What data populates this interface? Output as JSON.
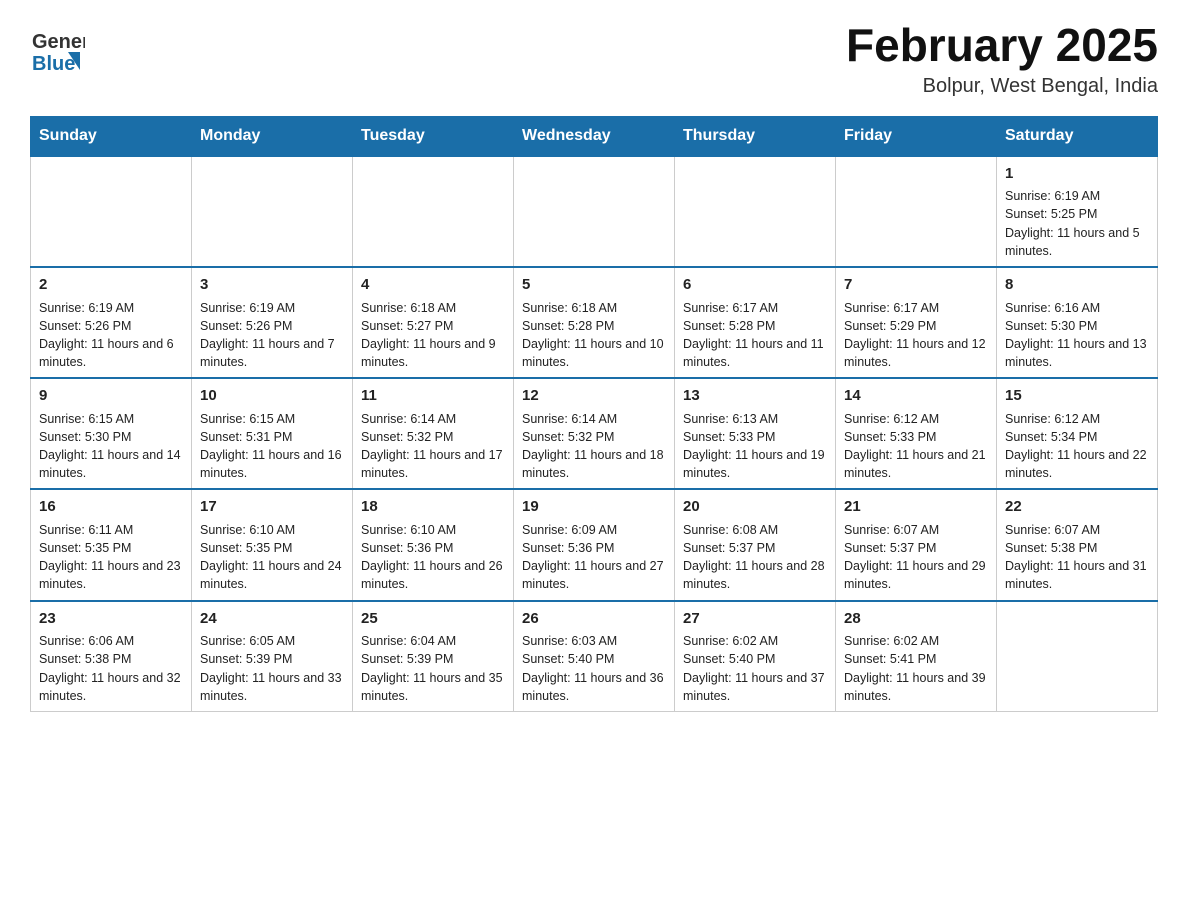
{
  "header": {
    "logo_general": "General",
    "logo_blue": "Blue",
    "title": "February 2025",
    "subtitle": "Bolpur, West Bengal, India"
  },
  "weekdays": [
    "Sunday",
    "Monday",
    "Tuesday",
    "Wednesday",
    "Thursday",
    "Friday",
    "Saturday"
  ],
  "weeks": [
    [
      {
        "day": "",
        "info": ""
      },
      {
        "day": "",
        "info": ""
      },
      {
        "day": "",
        "info": ""
      },
      {
        "day": "",
        "info": ""
      },
      {
        "day": "",
        "info": ""
      },
      {
        "day": "",
        "info": ""
      },
      {
        "day": "1",
        "info": "Sunrise: 6:19 AM\nSunset: 5:25 PM\nDaylight: 11 hours and 5 minutes."
      }
    ],
    [
      {
        "day": "2",
        "info": "Sunrise: 6:19 AM\nSunset: 5:26 PM\nDaylight: 11 hours and 6 minutes."
      },
      {
        "day": "3",
        "info": "Sunrise: 6:19 AM\nSunset: 5:26 PM\nDaylight: 11 hours and 7 minutes."
      },
      {
        "day": "4",
        "info": "Sunrise: 6:18 AM\nSunset: 5:27 PM\nDaylight: 11 hours and 9 minutes."
      },
      {
        "day": "5",
        "info": "Sunrise: 6:18 AM\nSunset: 5:28 PM\nDaylight: 11 hours and 10 minutes."
      },
      {
        "day": "6",
        "info": "Sunrise: 6:17 AM\nSunset: 5:28 PM\nDaylight: 11 hours and 11 minutes."
      },
      {
        "day": "7",
        "info": "Sunrise: 6:17 AM\nSunset: 5:29 PM\nDaylight: 11 hours and 12 minutes."
      },
      {
        "day": "8",
        "info": "Sunrise: 6:16 AM\nSunset: 5:30 PM\nDaylight: 11 hours and 13 minutes."
      }
    ],
    [
      {
        "day": "9",
        "info": "Sunrise: 6:15 AM\nSunset: 5:30 PM\nDaylight: 11 hours and 14 minutes."
      },
      {
        "day": "10",
        "info": "Sunrise: 6:15 AM\nSunset: 5:31 PM\nDaylight: 11 hours and 16 minutes."
      },
      {
        "day": "11",
        "info": "Sunrise: 6:14 AM\nSunset: 5:32 PM\nDaylight: 11 hours and 17 minutes."
      },
      {
        "day": "12",
        "info": "Sunrise: 6:14 AM\nSunset: 5:32 PM\nDaylight: 11 hours and 18 minutes."
      },
      {
        "day": "13",
        "info": "Sunrise: 6:13 AM\nSunset: 5:33 PM\nDaylight: 11 hours and 19 minutes."
      },
      {
        "day": "14",
        "info": "Sunrise: 6:12 AM\nSunset: 5:33 PM\nDaylight: 11 hours and 21 minutes."
      },
      {
        "day": "15",
        "info": "Sunrise: 6:12 AM\nSunset: 5:34 PM\nDaylight: 11 hours and 22 minutes."
      }
    ],
    [
      {
        "day": "16",
        "info": "Sunrise: 6:11 AM\nSunset: 5:35 PM\nDaylight: 11 hours and 23 minutes."
      },
      {
        "day": "17",
        "info": "Sunrise: 6:10 AM\nSunset: 5:35 PM\nDaylight: 11 hours and 24 minutes."
      },
      {
        "day": "18",
        "info": "Sunrise: 6:10 AM\nSunset: 5:36 PM\nDaylight: 11 hours and 26 minutes."
      },
      {
        "day": "19",
        "info": "Sunrise: 6:09 AM\nSunset: 5:36 PM\nDaylight: 11 hours and 27 minutes."
      },
      {
        "day": "20",
        "info": "Sunrise: 6:08 AM\nSunset: 5:37 PM\nDaylight: 11 hours and 28 minutes."
      },
      {
        "day": "21",
        "info": "Sunrise: 6:07 AM\nSunset: 5:37 PM\nDaylight: 11 hours and 29 minutes."
      },
      {
        "day": "22",
        "info": "Sunrise: 6:07 AM\nSunset: 5:38 PM\nDaylight: 11 hours and 31 minutes."
      }
    ],
    [
      {
        "day": "23",
        "info": "Sunrise: 6:06 AM\nSunset: 5:38 PM\nDaylight: 11 hours and 32 minutes."
      },
      {
        "day": "24",
        "info": "Sunrise: 6:05 AM\nSunset: 5:39 PM\nDaylight: 11 hours and 33 minutes."
      },
      {
        "day": "25",
        "info": "Sunrise: 6:04 AM\nSunset: 5:39 PM\nDaylight: 11 hours and 35 minutes."
      },
      {
        "day": "26",
        "info": "Sunrise: 6:03 AM\nSunset: 5:40 PM\nDaylight: 11 hours and 36 minutes."
      },
      {
        "day": "27",
        "info": "Sunrise: 6:02 AM\nSunset: 5:40 PM\nDaylight: 11 hours and 37 minutes."
      },
      {
        "day": "28",
        "info": "Sunrise: 6:02 AM\nSunset: 5:41 PM\nDaylight: 11 hours and 39 minutes."
      },
      {
        "day": "",
        "info": ""
      }
    ]
  ]
}
